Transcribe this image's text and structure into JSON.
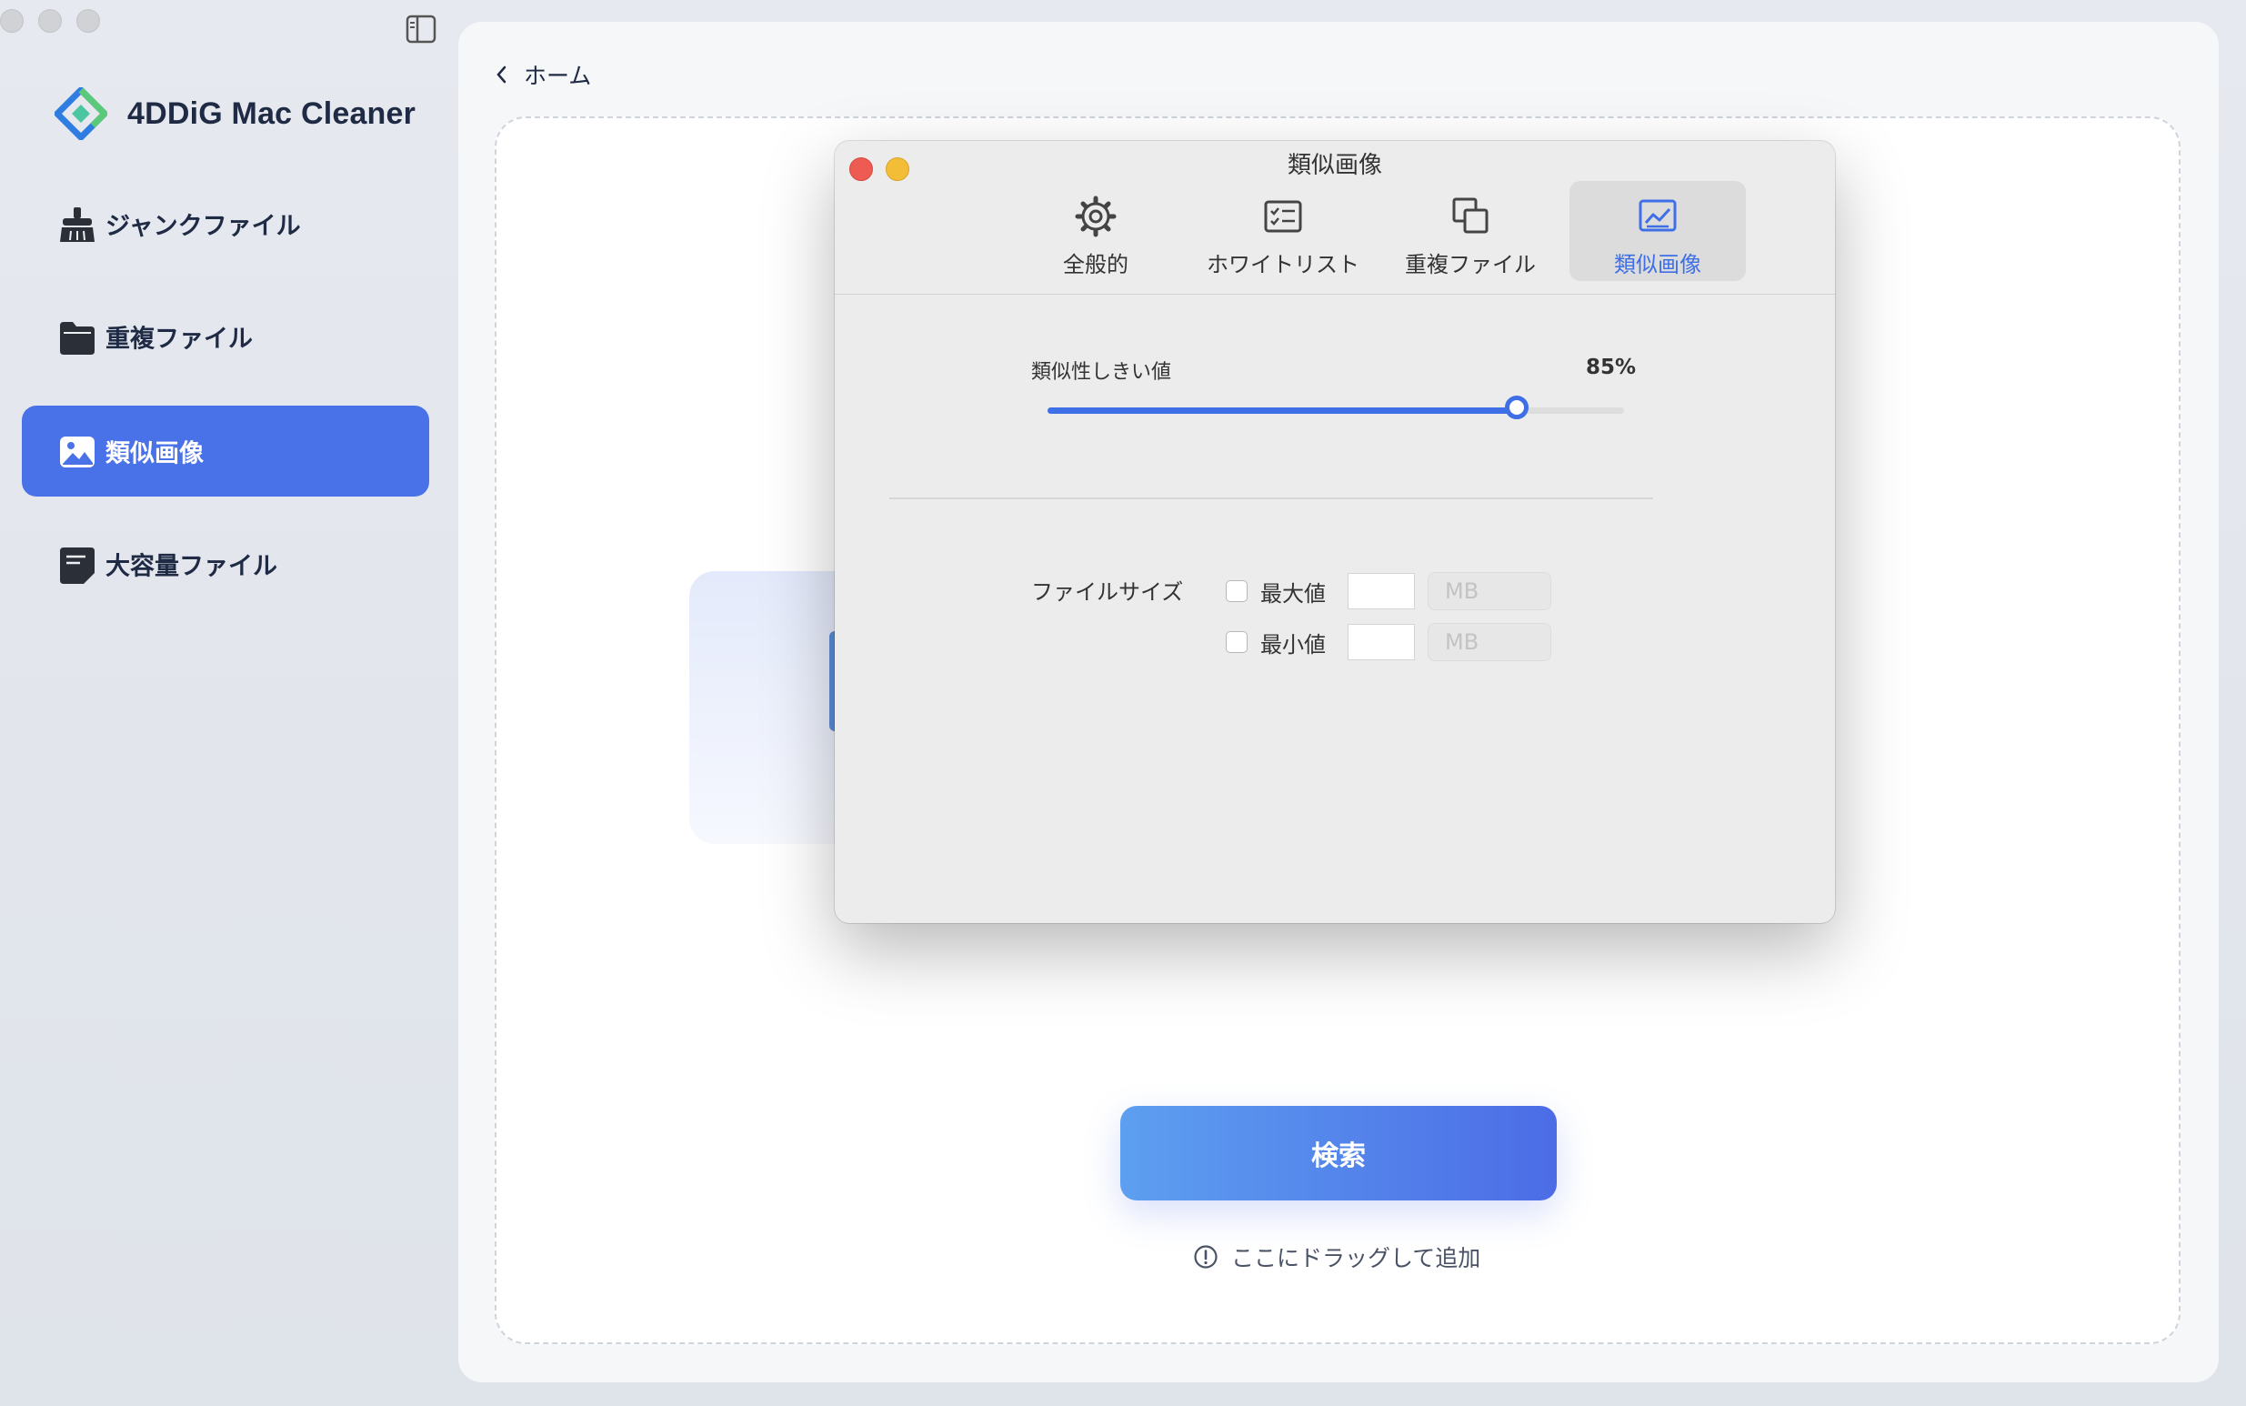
{
  "app": {
    "name": "4DDiG Mac Cleaner"
  },
  "nav": {
    "items": [
      {
        "label": "ジャンクファイル",
        "icon": "broom-icon",
        "active": false
      },
      {
        "label": "重複ファイル",
        "icon": "folder-icon",
        "active": false
      },
      {
        "label": "類似画像",
        "icon": "image-icon",
        "active": true
      },
      {
        "label": "大容量ファイル",
        "icon": "document-icon",
        "active": false
      }
    ]
  },
  "header": {
    "back_label": "ホーム"
  },
  "main": {
    "search_label": "検索",
    "drag_hint": "ここにドラッグして追加"
  },
  "dialog": {
    "title": "類似画像",
    "tabs": [
      {
        "label": "全般的",
        "icon": "gear-icon"
      },
      {
        "label": "ホワイトリスト",
        "icon": "checklist-icon"
      },
      {
        "label": "重複ファイル",
        "icon": "duplicate-icon"
      },
      {
        "label": "類似画像",
        "icon": "picture-icon",
        "selected": true
      }
    ],
    "threshold": {
      "label": "類似性しきい値",
      "value_text": "85%",
      "value": 85
    },
    "file_size": {
      "label": "ファイルサイズ",
      "max": {
        "label": "最大値",
        "checked": false,
        "value": "",
        "unit_placeholder": "MB"
      },
      "min": {
        "label": "最小値",
        "checked": false,
        "value": "",
        "unit_placeholder": "MB"
      }
    }
  },
  "colors": {
    "accent": "#4a72e8",
    "dialog_accent": "#3f6fe6"
  }
}
